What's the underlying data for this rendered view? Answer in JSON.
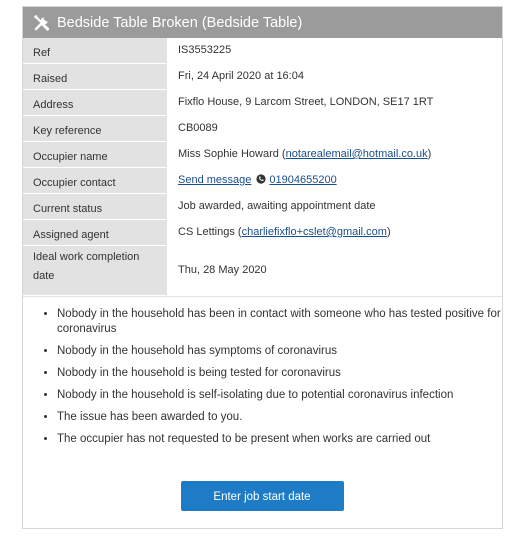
{
  "header": {
    "title": "Bedside Table Broken (Bedside Table)",
    "icon": "tools-icon"
  },
  "details": [
    {
      "label": "Ref",
      "value": "IS3553225"
    },
    {
      "label": "Raised",
      "value": "Fri, 24 April 2020 at 16:04"
    },
    {
      "label": "Address",
      "value": "Fixflo House, 9 Larcom Street, LONDON, SE17 1RT"
    },
    {
      "label": "Key reference",
      "value": "CB0089"
    },
    {
      "label": "Occupier name",
      "value_prefix": "Miss Sophie Howard (",
      "link": "notarealemail@hotmail.co.uk",
      "value_suffix": ")"
    },
    {
      "label": "Occupier contact",
      "link": "Send message",
      "phone": "01904655200"
    },
    {
      "label": "Current status",
      "value": "Job awarded, awaiting appointment date"
    },
    {
      "label": "Assigned agent",
      "value_prefix": "CS Lettings (",
      "link": "charliefixflo+cslet@gmail.com",
      "value_suffix": ")"
    },
    {
      "label": "Ideal work completion date",
      "value": "Thu, 28 May 2020"
    }
  ],
  "notes": [
    "Nobody in the household has been in contact with someone who has tested positive for coronavirus",
    "Nobody in the household has symptoms of coronavirus",
    "Nobody in the household is being tested for coronavirus",
    "Nobody in the household is self-isolating due to potential coronavirus infection",
    "The issue has been awarded to you.",
    "The occupier has not requested to be present when works are carried out"
  ],
  "actions": {
    "enter_start_date": "Enter job start date"
  },
  "colors": {
    "header_bg": "#9b9b9b",
    "label_bg": "#e2e2e2",
    "button_bg": "#1e7bc6",
    "link": "#1a4f8b"
  }
}
